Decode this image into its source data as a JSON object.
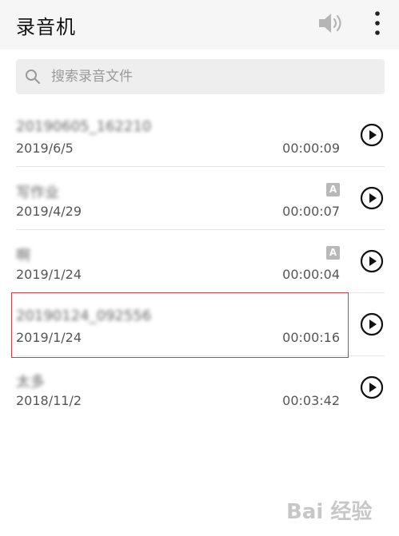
{
  "app": {
    "title": "录音机"
  },
  "search": {
    "placeholder": "搜索录音文件"
  },
  "recordings": [
    {
      "name": "20190605_162210",
      "date": "2019/6/5",
      "duration": "00:00:09",
      "badge": ""
    },
    {
      "name": "写作业",
      "date": "2019/4/29",
      "duration": "00:00:07",
      "badge": "A"
    },
    {
      "name": "啊",
      "date": "2019/1/24",
      "duration": "00:00:04",
      "badge": "A"
    },
    {
      "name": "20190124_092556",
      "date": "2019/1/24",
      "duration": "00:00:16",
      "badge": ""
    },
    {
      "name": "太多",
      "date": "2018/11/2",
      "duration": "00:03:42",
      "badge": ""
    }
  ],
  "icons": {
    "speaker": "speaker-icon",
    "more": "more-vertical-icon",
    "search": "search-icon",
    "play": "play-circle-icon"
  },
  "colors": {
    "highlight": "#d9393c"
  },
  "watermark": {
    "text": "Bai 经验"
  }
}
